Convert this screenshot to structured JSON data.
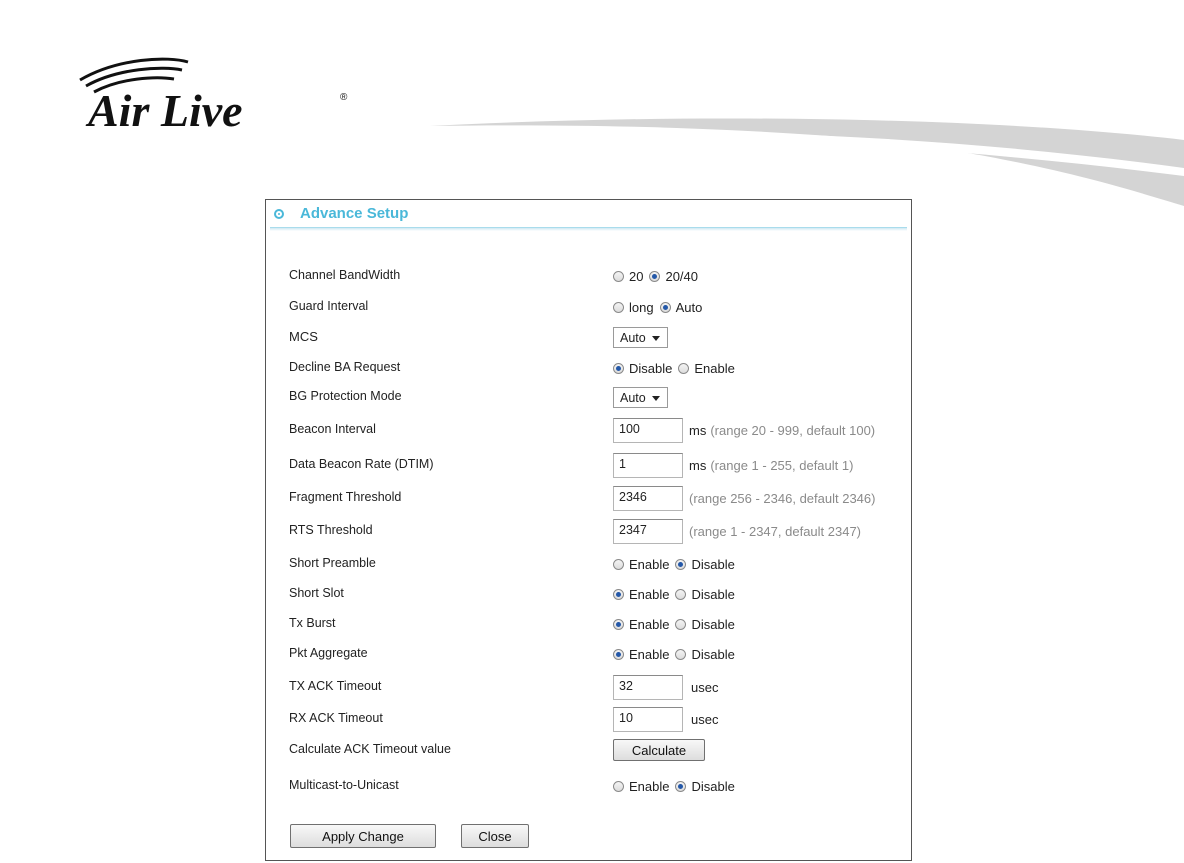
{
  "brand": {
    "logo_text": "Air Live",
    "registered": "®"
  },
  "panel": {
    "title": "Advance Setup"
  },
  "rows": {
    "channel_bandwidth": {
      "label": "Channel BandWidth",
      "options": [
        "20",
        "20/40"
      ],
      "selected": "20/40"
    },
    "guard_interval": {
      "label": "Guard Interval",
      "options": [
        "long",
        "Auto"
      ],
      "selected": "Auto"
    },
    "mcs": {
      "label": "MCS",
      "value": "Auto"
    },
    "decline_ba": {
      "label": "Decline BA Request",
      "options": [
        "Disable",
        "Enable"
      ],
      "selected": "Disable"
    },
    "bg_protection": {
      "label": "BG Protection Mode",
      "value": "Auto"
    },
    "beacon_interval": {
      "label": "Beacon Interval",
      "value": "100",
      "unit": "ms",
      "hint": "(range 20 - 999, default 100)"
    },
    "dtim": {
      "label": "Data Beacon Rate (DTIM)",
      "value": "1",
      "unit": "ms",
      "hint": "(range 1 - 255, default 1)"
    },
    "fragment": {
      "label": "Fragment Threshold",
      "value": "2346",
      "hint": "(range 256 - 2346, default 2346)"
    },
    "rts": {
      "label": "RTS Threshold",
      "value": "2347",
      "hint": "(range 1 - 2347, default 2347)"
    },
    "short_preamble": {
      "label": "Short Preamble",
      "options": [
        "Enable",
        "Disable"
      ],
      "selected": "Disable"
    },
    "short_slot": {
      "label": "Short Slot",
      "options": [
        "Enable",
        "Disable"
      ],
      "selected": "Enable"
    },
    "tx_burst": {
      "label": "Tx Burst",
      "options": [
        "Enable",
        "Disable"
      ],
      "selected": "Enable"
    },
    "pkt_aggregate": {
      "label": "Pkt Aggregate",
      "options": [
        "Enable",
        "Disable"
      ],
      "selected": "Enable"
    },
    "tx_ack": {
      "label": "TX ACK Timeout",
      "value": "32",
      "unit": "usec"
    },
    "rx_ack": {
      "label": "RX ACK Timeout",
      "value": "10",
      "unit": "usec"
    },
    "calc_ack": {
      "label": "Calculate ACK Timeout value",
      "button": "Calculate"
    },
    "multicast": {
      "label": "Multicast-to-Unicast",
      "options": [
        "Enable",
        "Disable"
      ],
      "selected": "Disable"
    }
  },
  "buttons": {
    "apply": "Apply Change",
    "close": "Close"
  },
  "colors": {
    "accent": "#4ab8d9",
    "radio_dot": "#2458a8",
    "hint": "#8a8a8a"
  }
}
